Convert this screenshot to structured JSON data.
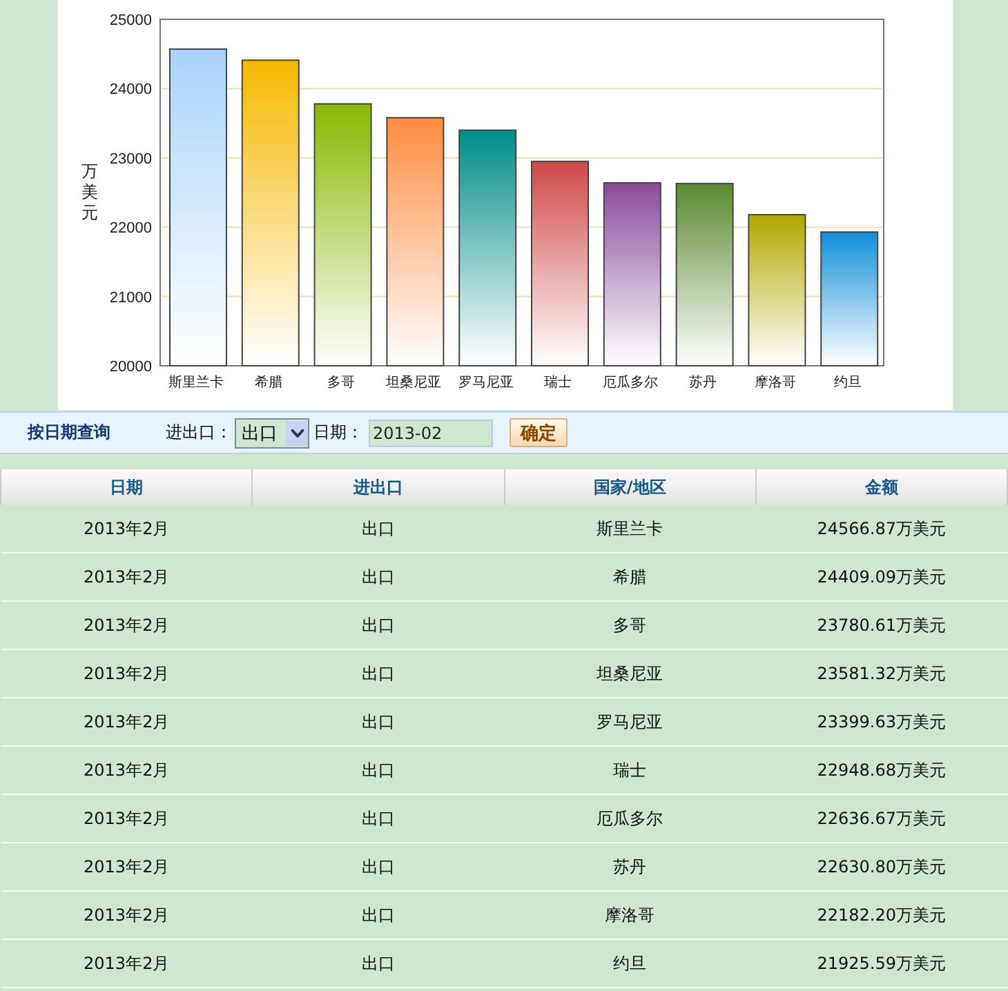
{
  "chart": {
    "chart_data": {
      "type": "bar",
      "ylabel": "万美元",
      "categories": [
        "斯里兰卡",
        "希腊",
        "多哥",
        "坦桑尼亚",
        "罗马尼亚",
        "瑞士",
        "厄瓜多尔",
        "苏丹",
        "摩洛哥",
        "约旦"
      ],
      "values": [
        24570,
        24410,
        23780,
        23580,
        23400,
        22950,
        22640,
        22630,
        22180,
        21930
      ],
      "ylim": [
        20000,
        25000
      ],
      "grid": true,
      "yticks": [
        20000,
        21000,
        22000,
        23000,
        24000,
        25000
      ]
    }
  },
  "filter": {
    "title": "按日期查询",
    "direction_label": "进出口：",
    "direction_value": "出口",
    "date_label": "日期：",
    "date_value": "2013-02",
    "submit": "确定"
  },
  "table": {
    "columns": [
      "日期",
      "进出口",
      "国家/地区",
      "金额"
    ],
    "rows": [
      [
        "2013年2月",
        "出口",
        "斯里兰卡",
        "24566.87万美元"
      ],
      [
        "2013年2月",
        "出口",
        "希腊",
        "24409.09万美元"
      ],
      [
        "2013年2月",
        "出口",
        "多哥",
        "23780.61万美元"
      ],
      [
        "2013年2月",
        "出口",
        "坦桑尼亚",
        "23581.32万美元"
      ],
      [
        "2013年2月",
        "出口",
        "罗马尼亚",
        "23399.63万美元"
      ],
      [
        "2013年2月",
        "出口",
        "瑞士",
        "22948.68万美元"
      ],
      [
        "2013年2月",
        "出口",
        "厄瓜多尔",
        "22636.67万美元"
      ],
      [
        "2013年2月",
        "出口",
        "苏丹",
        "22630.80万美元"
      ],
      [
        "2013年2月",
        "出口",
        "摩洛哥",
        "22182.20万美元"
      ],
      [
        "2013年2月",
        "出口",
        "约旦",
        "21925.59万美元"
      ]
    ]
  }
}
